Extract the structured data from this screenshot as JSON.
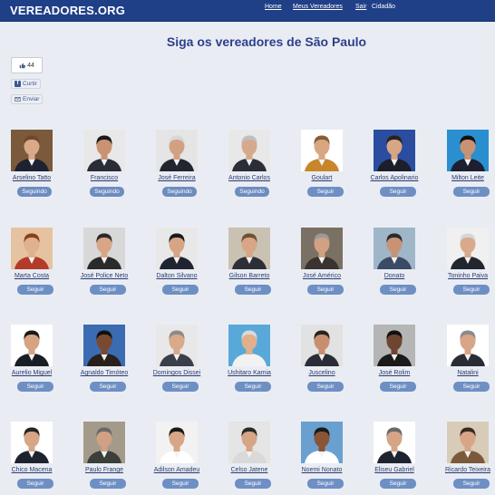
{
  "header": {
    "logo": "VEREADORES.ORG",
    "nav": {
      "home": "Home",
      "meus": "Meus Vereadores",
      "sair": "Sair",
      "user": "Cidadão"
    },
    "bg_color": "#1f3f87"
  },
  "title": "Siga os vereadores de São Paulo",
  "social": {
    "like_count": "44",
    "curtir": "Curtir",
    "enviar": "Enviar"
  },
  "colors": {
    "button": "#6e8fc4",
    "title": "#2e3f8c",
    "background": "#e9edf3"
  },
  "rows": [
    [
      {
        "name": "Arselino Tatto",
        "button": "Seguindo",
        "bg": "#7a5a3a",
        "skin": "#d9a98a",
        "hair": "#6b4a2b",
        "suit": "#1d2230"
      },
      {
        "name": "Francisco",
        "button": "Seguindo",
        "bg": "#e8e8e8",
        "skin": "#c99373",
        "hair": "#1a1a1a",
        "suit": "#2a2d35"
      },
      {
        "name": "José Ferreira",
        "button": "Seguindo",
        "bg": "#e5e5e5",
        "skin": "#d2a184",
        "hair": "#d8d8d8",
        "suit": "#22252d"
      },
      {
        "name": "Antonio Carlos",
        "button": "Seguindo",
        "bg": "#e8e8e8",
        "skin": "#d6a98c",
        "hair": "#bfbfbf",
        "suit": "#2b2e36"
      },
      {
        "name": "Goulart",
        "button": "Seguir",
        "bg": "#ffffff",
        "skin": "#d9a682",
        "hair": "#8a5c33",
        "suit": "#c8862a"
      },
      {
        "name": "Carlos Apolinario",
        "button": "Seguir",
        "bg": "#2a4da0",
        "skin": "#d7a685",
        "hair": "#2a2020",
        "suit": "#1c1f29"
      },
      {
        "name": "Milton Leite",
        "button": "Seguir",
        "bg": "#2a8fd0",
        "skin": "#c99373",
        "hair": "#111111",
        "suit": "#1c2030"
      }
    ],
    [
      {
        "name": "Marta Costa",
        "button": "Seguir",
        "bg": "#e6c3a0",
        "skin": "#e0b08f",
        "hair": "#8a3f1f",
        "suit": "#b43a2a"
      },
      {
        "name": "José Police Neto",
        "button": "Seguir",
        "bg": "#d8d8d8",
        "skin": "#d8a687",
        "hair": "#2a2a2a",
        "suit": "#2a2a2a"
      },
      {
        "name": "Dalton Silvano",
        "button": "Seguir",
        "bg": "#e8e8e8",
        "skin": "#d6a586",
        "hair": "#1a1a1a",
        "suit": "#1f2430"
      },
      {
        "name": "Gilson Barreto",
        "button": "Seguir",
        "bg": "#c9c2b3",
        "skin": "#d8a687",
        "hair": "#6f5234",
        "suit": "#2d2f36"
      },
      {
        "name": "José Américo",
        "button": "Seguir",
        "bg": "#7a7064",
        "skin": "#d2a082",
        "hair": "#9a9a9a",
        "suit": "#3a3330"
      },
      {
        "name": "Donato",
        "button": "Seguir",
        "bg": "#9fb6c9",
        "skin": "#c99373",
        "hair": "#2a2a2a",
        "suit": "#3b4a66"
      },
      {
        "name": "Toninho Paiva",
        "button": "Seguir",
        "bg": "#f0f0f0",
        "skin": "#d8a98b",
        "hair": "#d6d6d6",
        "suit": "#22262f"
      }
    ],
    [
      {
        "name": "Aurelio Miguel",
        "button": "Seguir",
        "bg": "#ffffff",
        "skin": "#d6a383",
        "hair": "#1a1a1a",
        "suit": "#1a1d26"
      },
      {
        "name": "Agnaldo Timóteo",
        "button": "Seguir",
        "bg": "#3b6bb0",
        "skin": "#7a4a30",
        "hair": "#111111",
        "suit": "#2a1f1a"
      },
      {
        "name": "Domingos Dissei",
        "button": "Seguir",
        "bg": "#e8e8e8",
        "skin": "#d8a98a",
        "hair": "#8a8a8a",
        "suit": "#3a3f4a"
      },
      {
        "name": "Ushitaro Kamia",
        "button": "Seguir",
        "bg": "#58a9d9",
        "skin": "#e0b08c",
        "hair": "#d9d9d9",
        "suit": "#f2f2f2"
      },
      {
        "name": "Juscelino",
        "button": "Seguir",
        "bg": "#e2e2e2",
        "skin": "#c88f6e",
        "hair": "#2a2420",
        "suit": "#2a2d35"
      },
      {
        "name": "José Rolim",
        "button": "Seguir",
        "bg": "#b5b5b5",
        "skin": "#6e4530",
        "hair": "#111111",
        "suit": "#1a1a1a"
      },
      {
        "name": "Natalini",
        "button": "Seguir",
        "bg": "#ffffff",
        "skin": "#d8a586",
        "hair": "#8a8a8a",
        "suit": "#2a2d35"
      }
    ],
    [
      {
        "name": "Chico Macena",
        "button": "Seguir",
        "bg": "#ffffff",
        "skin": "#d8a586",
        "hair": "#2a2420",
        "suit": "#1f2330"
      },
      {
        "name": "Paulo Frange",
        "button": "Seguir",
        "bg": "#a39a8a",
        "skin": "#d2a083",
        "hair": "#6a6a6a",
        "suit": "#3a3f3a"
      },
      {
        "name": "Adilson Amadeu",
        "button": "Seguir",
        "bg": "#f2f2f2",
        "skin": "#d8a687",
        "hair": "#1a1a1a",
        "suit": "#ffffff"
      },
      {
        "name": "Celso Jatene",
        "button": "Seguir",
        "bg": "#e5e5e5",
        "skin": "#d6a586",
        "hair": "#2a2a2a",
        "suit": "#d9d9d9"
      },
      {
        "name": "Noemi Nonato",
        "button": "Seguir",
        "bg": "#6aa0cf",
        "skin": "#8a5535",
        "hair": "#1a1a1a",
        "suit": "#ffffff"
      },
      {
        "name": "Eliseu Gabriel",
        "button": "Seguir",
        "bg": "#ffffff",
        "skin": "#d6a586",
        "hair": "#6a6a6a",
        "suit": "#1f2330"
      },
      {
        "name": "Ricardo Teixeira",
        "button": "Seguir",
        "bg": "#d8ccb8",
        "skin": "#d8a586",
        "hair": "#3a2a20",
        "suit": "#7a5a3a"
      }
    ]
  ]
}
